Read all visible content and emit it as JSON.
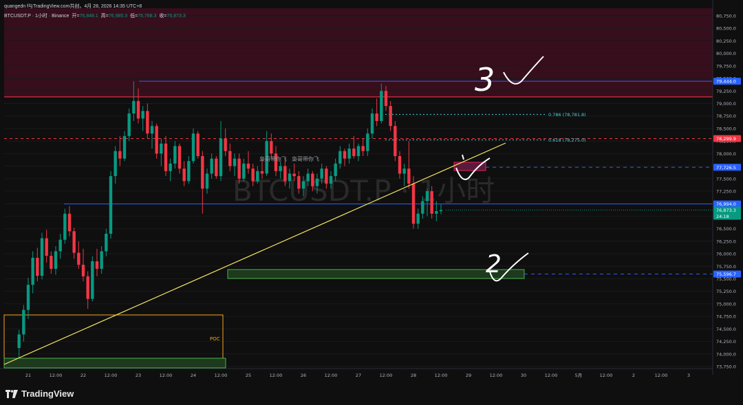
{
  "header": {
    "attribution": "quangedn f与TradingView.com共创，4月 28, 2026 14:35 UTC+8",
    "symbol_line": "BTCUSDT.P · 1小时 · Binance",
    "ohlc": [
      {
        "label": "开=",
        "value": "76,848.1"
      },
      {
        "label": "高=",
        "value": "76,985.3"
      },
      {
        "label": "低=",
        "value": "76,788.3"
      },
      {
        "label": "收=",
        "value": "76,873.3"
      }
    ]
  },
  "watermark": "BTCUSDT.P · 1小时",
  "chart_texts": {
    "author_tags": [
      "枭哥带你飞",
      "枭哥带你飞"
    ],
    "poc": "POC",
    "fib_786": "0.786 (78,781.8)",
    "fib_618": "0.618 (78,275.0)",
    "handwritten": [
      "3",
      "2"
    ]
  },
  "price_axis": {
    "ticks": [
      "80,750.0",
      "80,500.0",
      "80,250.0",
      "80,000.0",
      "79,750.0",
      "79,500.0",
      "79,250.0",
      "79,000.0",
      "78,750.0",
      "78,500.0",
      "78,250.0",
      "78,000.0",
      "77,750.0",
      "77,500.0",
      "77,250.0",
      "77,000.0",
      "76,750.0",
      "76,500.0",
      "76,250.0",
      "76,000.0",
      "75,750.0",
      "75,500.0",
      "75,250.0",
      "75,000.0",
      "74,750.0",
      "74,500.0",
      "74,250.0",
      "74,000.0",
      "73,750.0"
    ],
    "badges": [
      {
        "label": "79,444.0",
        "color": "#2962ff"
      },
      {
        "label": "78,299.9",
        "color": "#f23645"
      },
      {
        "label": "77,726.5",
        "color": "#2962ff"
      },
      {
        "label": "76,994.0",
        "color": "#2962ff"
      },
      {
        "label": "76,873.3",
        "color": "#089981"
      },
      {
        "label": "24:18",
        "color": "#089981"
      },
      {
        "label": "75,596.7",
        "color": "#2962ff"
      }
    ]
  },
  "time_axis": {
    "ticks": [
      "21",
      "12:00",
      "22",
      "12:00",
      "23",
      "12:00",
      "24",
      "12:00",
      "25",
      "12:00",
      "26",
      "12:00",
      "27",
      "12:00",
      "28",
      "12:00",
      "29",
      "12:00",
      "30",
      "12:00",
      "5月",
      "12:00",
      "2",
      "12:00",
      "3"
    ]
  },
  "footer": {
    "brand": "TradingView"
  },
  "colors": {
    "background": "#0f0f0f",
    "up": "#089981",
    "down": "#f23645",
    "supply_zone": "#3a0f1e",
    "demand_zone": "#1d3a1d",
    "trendline": "#f5e663",
    "level_blue": "#2962ff",
    "level_red": "#f23645"
  },
  "chart_data": {
    "type": "candlestick",
    "symbol": "BTCUSDT.P",
    "timeframe": "1小时",
    "exchange": "Binance",
    "x_range": [
      "2026-04-20T20:00",
      "2026-05-03T12:00"
    ],
    "ylim": [
      73750,
      80750
    ],
    "last_price": 76873.3,
    "ohlc": [
      {
        "t": "2026-04-20T20:00",
        "o": 74120,
        "h": 74480,
        "l": 73920,
        "c": 74390
      },
      {
        "t": "2026-04-20T22:00",
        "o": 74390,
        "h": 74980,
        "l": 74250,
        "c": 74880
      },
      {
        "t": "2026-04-21T00:00",
        "o": 74880,
        "h": 75520,
        "l": 74700,
        "c": 75380
      },
      {
        "t": "2026-04-21T02:00",
        "o": 75380,
        "h": 76050,
        "l": 75210,
        "c": 75920
      },
      {
        "t": "2026-04-21T04:00",
        "o": 75920,
        "h": 76120,
        "l": 75450,
        "c": 75560
      },
      {
        "t": "2026-04-21T06:00",
        "o": 75560,
        "h": 76420,
        "l": 75490,
        "c": 76310
      },
      {
        "t": "2026-04-21T08:00",
        "o": 76310,
        "h": 76480,
        "l": 75820,
        "c": 75960
      },
      {
        "t": "2026-04-21T10:00",
        "o": 75960,
        "h": 76050,
        "l": 75600,
        "c": 75700
      },
      {
        "t": "2026-04-21T12:00",
        "o": 75700,
        "h": 76150,
        "l": 75580,
        "c": 76050
      },
      {
        "t": "2026-04-21T14:00",
        "o": 76050,
        "h": 76400,
        "l": 75900,
        "c": 76280
      },
      {
        "t": "2026-04-21T16:00",
        "o": 76280,
        "h": 76900,
        "l": 76200,
        "c": 76800
      },
      {
        "t": "2026-04-21T18:00",
        "o": 76800,
        "h": 76950,
        "l": 76350,
        "c": 76450
      },
      {
        "t": "2026-04-21T20:00",
        "o": 76450,
        "h": 76520,
        "l": 75900,
        "c": 76020
      },
      {
        "t": "2026-04-21T22:00",
        "o": 76020,
        "h": 76250,
        "l": 75700,
        "c": 75780
      },
      {
        "t": "2026-04-22T00:00",
        "o": 75780,
        "h": 76100,
        "l": 75450,
        "c": 75550
      },
      {
        "t": "2026-04-22T02:00",
        "o": 75550,
        "h": 75650,
        "l": 74900,
        "c": 75100
      },
      {
        "t": "2026-04-22T04:00",
        "o": 75100,
        "h": 75950,
        "l": 75050,
        "c": 75850
      },
      {
        "t": "2026-04-22T06:00",
        "o": 75850,
        "h": 76100,
        "l": 75550,
        "c": 75700
      },
      {
        "t": "2026-04-22T08:00",
        "o": 75700,
        "h": 76150,
        "l": 75600,
        "c": 76050
      },
      {
        "t": "2026-04-22T10:00",
        "o": 76050,
        "h": 76500,
        "l": 75950,
        "c": 76400
      },
      {
        "t": "2026-04-22T12:00",
        "o": 76400,
        "h": 77650,
        "l": 76300,
        "c": 77550
      },
      {
        "t": "2026-04-22T14:00",
        "o": 77550,
        "h": 78150,
        "l": 77400,
        "c": 78050
      },
      {
        "t": "2026-04-22T16:00",
        "o": 78050,
        "h": 78350,
        "l": 77750,
        "c": 77900
      },
      {
        "t": "2026-04-22T18:00",
        "o": 77900,
        "h": 78450,
        "l": 77850,
        "c": 78350
      },
      {
        "t": "2026-04-22T20:00",
        "o": 78350,
        "h": 78900,
        "l": 78250,
        "c": 78800
      },
      {
        "t": "2026-04-22T22:00",
        "o": 78800,
        "h": 79444,
        "l": 78650,
        "c": 79050
      },
      {
        "t": "2026-04-23T00:00",
        "o": 79050,
        "h": 79300,
        "l": 78600,
        "c": 78700
      },
      {
        "t": "2026-04-23T02:00",
        "o": 78700,
        "h": 78950,
        "l": 78450,
        "c": 78850
      },
      {
        "t": "2026-04-23T04:00",
        "o": 78850,
        "h": 79000,
        "l": 78300,
        "c": 78400
      },
      {
        "t": "2026-04-23T06:00",
        "o": 78400,
        "h": 78650,
        "l": 78100,
        "c": 78550
      },
      {
        "t": "2026-04-23T08:00",
        "o": 78550,
        "h": 78600,
        "l": 77900,
        "c": 78000
      },
      {
        "t": "2026-04-23T10:00",
        "o": 78000,
        "h": 78300,
        "l": 77750,
        "c": 78200
      },
      {
        "t": "2026-04-23T12:00",
        "o": 78200,
        "h": 78350,
        "l": 77550,
        "c": 77650
      },
      {
        "t": "2026-04-23T14:00",
        "o": 77650,
        "h": 77900,
        "l": 77450,
        "c": 77800
      },
      {
        "t": "2026-04-23T16:00",
        "o": 77800,
        "h": 78250,
        "l": 77700,
        "c": 78150
      },
      {
        "t": "2026-04-23T18:00",
        "o": 78150,
        "h": 78200,
        "l": 77600,
        "c": 77700
      },
      {
        "t": "2026-04-23T20:00",
        "o": 77700,
        "h": 77850,
        "l": 77350,
        "c": 77450
      },
      {
        "t": "2026-04-23T22:00",
        "o": 77450,
        "h": 77950,
        "l": 77400,
        "c": 77850
      },
      {
        "t": "2026-04-24T00:00",
        "o": 77850,
        "h": 78500,
        "l": 77800,
        "c": 78400
      },
      {
        "t": "2026-04-24T02:00",
        "o": 78400,
        "h": 78450,
        "l": 77900,
        "c": 77950
      },
      {
        "t": "2026-04-24T04:00",
        "o": 77950,
        "h": 78050,
        "l": 76800,
        "c": 77300
      },
      {
        "t": "2026-04-24T06:00",
        "o": 77300,
        "h": 77700,
        "l": 77200,
        "c": 77600
      },
      {
        "t": "2026-04-24T08:00",
        "o": 77600,
        "h": 78000,
        "l": 77500,
        "c": 77900
      },
      {
        "t": "2026-04-24T10:00",
        "o": 77900,
        "h": 77950,
        "l": 77500,
        "c": 77550
      },
      {
        "t": "2026-04-24T12:00",
        "o": 77550,
        "h": 78650,
        "l": 77450,
        "c": 78300
      },
      {
        "t": "2026-04-24T14:00",
        "o": 78300,
        "h": 78500,
        "l": 77950,
        "c": 78050
      },
      {
        "t": "2026-04-24T16:00",
        "o": 78050,
        "h": 78200,
        "l": 77650,
        "c": 77750
      },
      {
        "t": "2026-04-24T18:00",
        "o": 77750,
        "h": 78000,
        "l": 77550,
        "c": 77900
      },
      {
        "t": "2026-04-24T20:00",
        "o": 77900,
        "h": 78000,
        "l": 77400,
        "c": 77500
      },
      {
        "t": "2026-04-24T22:00",
        "o": 77500,
        "h": 77900,
        "l": 77450,
        "c": 77800
      },
      {
        "t": "2026-04-25T00:00",
        "o": 77800,
        "h": 78050,
        "l": 77600,
        "c": 77700
      },
      {
        "t": "2026-04-25T02:00",
        "o": 77700,
        "h": 77800,
        "l": 77350,
        "c": 77450
      },
      {
        "t": "2026-04-25T04:00",
        "o": 77450,
        "h": 77750,
        "l": 77400,
        "c": 77650
      },
      {
        "t": "2026-04-25T06:00",
        "o": 77650,
        "h": 77900,
        "l": 77500,
        "c": 77600
      },
      {
        "t": "2026-04-25T08:00",
        "o": 77600,
        "h": 78450,
        "l": 77550,
        "c": 78250
      },
      {
        "t": "2026-04-25T10:00",
        "o": 78250,
        "h": 78400,
        "l": 77900,
        "c": 78000
      },
      {
        "t": "2026-04-25T12:00",
        "o": 78000,
        "h": 78150,
        "l": 77550,
        "c": 77650
      },
      {
        "t": "2026-04-25T14:00",
        "o": 77650,
        "h": 77850,
        "l": 77500,
        "c": 77750
      },
      {
        "t": "2026-04-25T16:00",
        "o": 77750,
        "h": 77900,
        "l": 77350,
        "c": 77450
      },
      {
        "t": "2026-04-25T18:00",
        "o": 77450,
        "h": 77700,
        "l": 77300,
        "c": 77600
      },
      {
        "t": "2026-04-25T20:00",
        "o": 77600,
        "h": 77800,
        "l": 77450,
        "c": 77550
      },
      {
        "t": "2026-04-25T22:00",
        "o": 77550,
        "h": 77650,
        "l": 77200,
        "c": 77300
      },
      {
        "t": "2026-04-26T00:00",
        "o": 77300,
        "h": 77550,
        "l": 77150,
        "c": 77450
      },
      {
        "t": "2026-04-26T02:00",
        "o": 77450,
        "h": 77700,
        "l": 77350,
        "c": 77600
      },
      {
        "t": "2026-04-26T04:00",
        "o": 77600,
        "h": 77650,
        "l": 77250,
        "c": 77350
      },
      {
        "t": "2026-04-26T06:00",
        "o": 77350,
        "h": 77600,
        "l": 77200,
        "c": 77500
      },
      {
        "t": "2026-04-26T08:00",
        "o": 77500,
        "h": 77800,
        "l": 77400,
        "c": 77700
      },
      {
        "t": "2026-04-26T10:00",
        "o": 77700,
        "h": 77750,
        "l": 77300,
        "c": 77400
      },
      {
        "t": "2026-04-26T12:00",
        "o": 77400,
        "h": 77650,
        "l": 77300,
        "c": 77550
      },
      {
        "t": "2026-04-26T14:00",
        "o": 77550,
        "h": 77900,
        "l": 77450,
        "c": 77800
      },
      {
        "t": "2026-04-26T16:00",
        "o": 77800,
        "h": 78150,
        "l": 77700,
        "c": 78050
      },
      {
        "t": "2026-04-26T18:00",
        "o": 78050,
        "h": 78100,
        "l": 77750,
        "c": 77900
      },
      {
        "t": "2026-04-26T20:00",
        "o": 77900,
        "h": 78200,
        "l": 77800,
        "c": 78100
      },
      {
        "t": "2026-04-26T22:00",
        "o": 78100,
        "h": 78350,
        "l": 77900,
        "c": 77950
      },
      {
        "t": "2026-04-27T00:00",
        "o": 77950,
        "h": 78200,
        "l": 77850,
        "c": 78150
      },
      {
        "t": "2026-04-27T02:00",
        "o": 78150,
        "h": 78300,
        "l": 77950,
        "c": 78050
      },
      {
        "t": "2026-04-27T04:00",
        "o": 78050,
        "h": 78500,
        "l": 77950,
        "c": 78400
      },
      {
        "t": "2026-04-27T06:00",
        "o": 78400,
        "h": 78900,
        "l": 78300,
        "c": 78800
      },
      {
        "t": "2026-04-27T08:00",
        "o": 78800,
        "h": 79100,
        "l": 78550,
        "c": 78650
      },
      {
        "t": "2026-04-27T10:00",
        "o": 78650,
        "h": 79400,
        "l": 78600,
        "c": 79250
      },
      {
        "t": "2026-04-27T12:00",
        "o": 79250,
        "h": 79350,
        "l": 78850,
        "c": 78950
      },
      {
        "t": "2026-04-27T14:00",
        "o": 78950,
        "h": 79050,
        "l": 78450,
        "c": 78550
      },
      {
        "t": "2026-04-27T16:00",
        "o": 78550,
        "h": 78650,
        "l": 77850,
        "c": 77950
      },
      {
        "t": "2026-04-27T18:00",
        "o": 77950,
        "h": 78050,
        "l": 77500,
        "c": 77600
      },
      {
        "t": "2026-04-27T20:00",
        "o": 77600,
        "h": 77800,
        "l": 77350,
        "c": 77700
      },
      {
        "t": "2026-04-27T22:00",
        "o": 77700,
        "h": 78250,
        "l": 77300,
        "c": 77400
      },
      {
        "t": "2026-04-28T00:00",
        "o": 77400,
        "h": 77550,
        "l": 76500,
        "c": 76600
      },
      {
        "t": "2026-04-28T02:00",
        "o": 76600,
        "h": 76900,
        "l": 76500,
        "c": 76800
      },
      {
        "t": "2026-04-28T04:00",
        "o": 76800,
        "h": 77150,
        "l": 76700,
        "c": 77050
      },
      {
        "t": "2026-04-28T06:00",
        "o": 77050,
        "h": 77300,
        "l": 76750,
        "c": 77250
      },
      {
        "t": "2026-04-28T08:00",
        "o": 77250,
        "h": 77350,
        "l": 76700,
        "c": 76800
      },
      {
        "t": "2026-04-28T10:00",
        "o": 76800,
        "h": 77050,
        "l": 76650,
        "c": 76850
      },
      {
        "t": "2026-04-28T12:00",
        "o": 76850,
        "h": 76985,
        "l": 76788,
        "c": 76873
      }
    ]
  }
}
